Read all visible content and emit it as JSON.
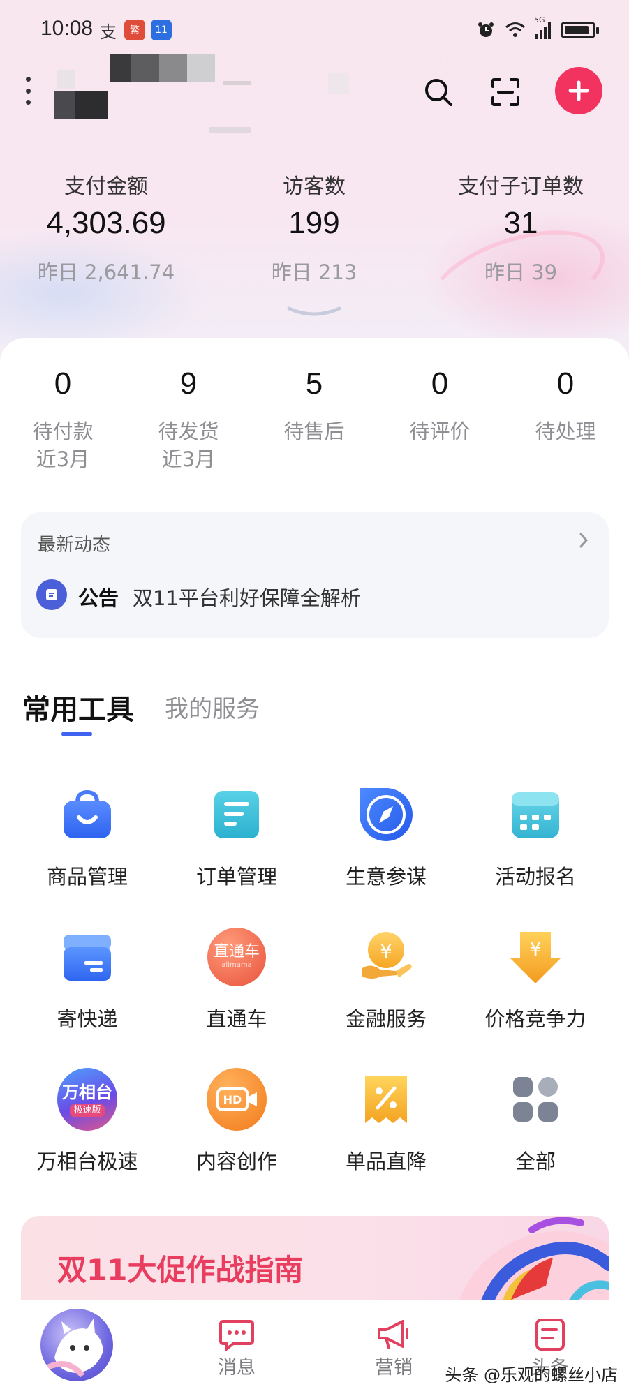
{
  "status_bar": {
    "time": "10:08",
    "app_icons": [
      "支",
      "繁",
      "11"
    ],
    "network": "5G"
  },
  "header": {
    "menu_icon": "more-vertical-icon",
    "search_icon": "search-icon",
    "scan_icon": "scan-icon",
    "add_icon": "plus-icon",
    "accent_color": "#f2335f"
  },
  "stats": [
    {
      "label": "支付金额",
      "value": "4,303.69",
      "yesterday": "昨日 2,641.74"
    },
    {
      "label": "访客数",
      "value": "199",
      "yesterday": "昨日 213"
    },
    {
      "label": "支付子订单数",
      "value": "31",
      "yesterday": "昨日 39"
    }
  ],
  "orders": [
    {
      "count": "0",
      "label": "待付款",
      "sub": "近3月"
    },
    {
      "count": "9",
      "label": "待发货",
      "sub": "近3月"
    },
    {
      "count": "5",
      "label": "待售后",
      "sub": ""
    },
    {
      "count": "0",
      "label": "待评价",
      "sub": ""
    },
    {
      "count": "0",
      "label": "待处理",
      "sub": ""
    }
  ],
  "news": {
    "title": "最新动态",
    "tag": "公告",
    "text": "双11平台利好保障全解析"
  },
  "tabs": {
    "active": "常用工具",
    "other": "我的服务"
  },
  "tools": [
    {
      "label": "商品管理",
      "icon": "shopping-bag-icon"
    },
    {
      "label": "订单管理",
      "icon": "order-list-icon"
    },
    {
      "label": "生意参谋",
      "icon": "compass-icon"
    },
    {
      "label": "活动报名",
      "icon": "calendar-icon"
    },
    {
      "label": "寄快递",
      "icon": "delivery-box-icon"
    },
    {
      "label": "直通车",
      "icon": "ztc-icon",
      "badge_text": "直通车",
      "badge_sub": "alimama"
    },
    {
      "label": "金融服务",
      "icon": "yuan-hand-icon"
    },
    {
      "label": "价格竞争力",
      "icon": "yuan-down-icon"
    },
    {
      "label": "万相台极速",
      "icon": "wxt-icon",
      "badge_text": "万相台",
      "badge_sub": "极速版"
    },
    {
      "label": "内容创作",
      "icon": "hd-video-icon",
      "badge_text": "HD"
    },
    {
      "label": "单品直降",
      "icon": "discount-ticket-icon"
    },
    {
      "label": "全部",
      "icon": "grid-all-icon"
    }
  ],
  "banner": {
    "title": "双11大促作战指南"
  },
  "bottom_nav": [
    {
      "label": "消息",
      "icon": "message-icon"
    },
    {
      "label": "营销",
      "icon": "megaphone-icon"
    },
    {
      "label": "头条",
      "icon": "news-icon"
    }
  ],
  "watermark": "头条 @乐观的螺丝小店"
}
